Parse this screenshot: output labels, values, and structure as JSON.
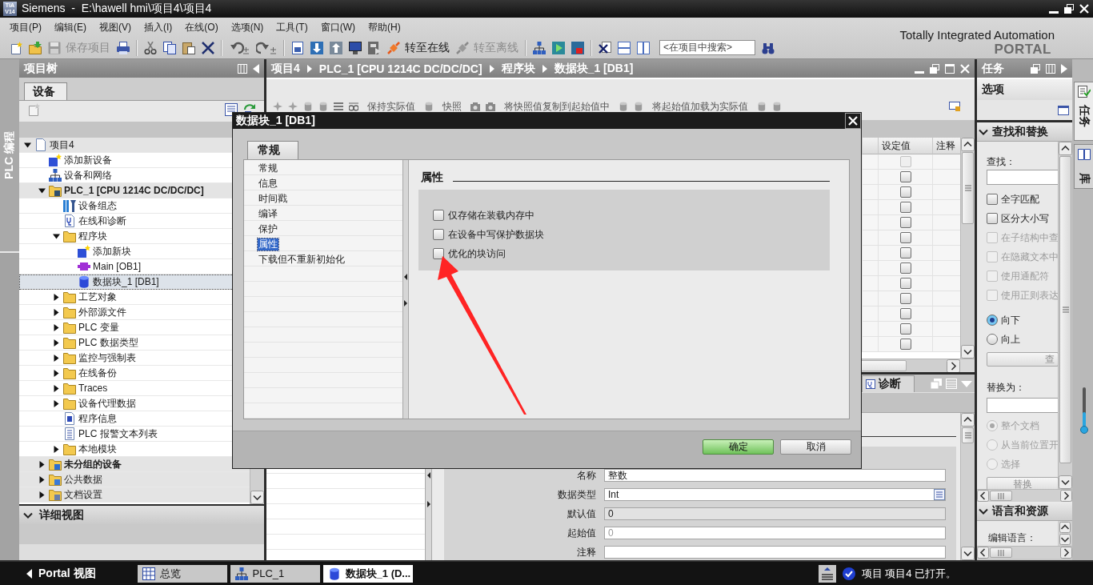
{
  "window": {
    "logo": [
      "TIA",
      "V14"
    ],
    "title": "Siemens  -  E:\\hawell hmi\\项目4\\项目4"
  },
  "menu": [
    "项目(P)",
    "编辑(E)",
    "视图(V)",
    "插入(I)",
    "在线(O)",
    "选项(N)",
    "工具(T)",
    "窗口(W)",
    "帮助(H)"
  ],
  "toolbar": {
    "save": {
      "label": "保存项目",
      "disabled": true
    },
    "online": {
      "label": "转至在线",
      "disabled": false
    },
    "offline": {
      "label": "转至离线",
      "disabled": true
    },
    "search": {
      "placeholder": "<在项目中搜索>"
    }
  },
  "branding": {
    "tagline": "Totally Integrated Automation",
    "product": "PORTAL"
  },
  "left_strip": {
    "tabs": [
      {
        "label": "PLC 编程",
        "selected": true
      }
    ]
  },
  "project_tree": {
    "title": "项目树",
    "tabs": [
      {
        "label": "设备",
        "selected": true
      }
    ],
    "items": [
      {
        "label": "项目4",
        "kind": "project",
        "expanded": true,
        "selected": false,
        "children": [
          {
            "label": "添加新设备",
            "kind": "add",
            "selected": false
          },
          {
            "label": "设备和网络",
            "kind": "network",
            "selected": false
          },
          {
            "label": "PLC_1 [CPU 1214C DC/DC/DC]",
            "kind": "plc",
            "expanded": true,
            "selected": false,
            "children": [
              {
                "label": "设备组态",
                "kind": "config",
                "selected": false
              },
              {
                "label": "在线和诊断",
                "kind": "diagnostics",
                "selected": false
              },
              {
                "label": "程序块",
                "kind": "folder",
                "expanded": true,
                "selected": false,
                "children": [
                  {
                    "label": "添加新块",
                    "kind": "add",
                    "selected": false
                  },
                  {
                    "label": "Main [OB1]",
                    "kind": "ob",
                    "selected": false
                  },
                  {
                    "label": "数据块_1 [DB1]",
                    "kind": "db",
                    "selected": true
                  }
                ]
              },
              {
                "label": "工艺对象",
                "kind": "folder",
                "expanded": false,
                "selected": false
              },
              {
                "label": "外部源文件",
                "kind": "folder",
                "expanded": false,
                "selected": false
              },
              {
                "label": "PLC 变量",
                "kind": "folder",
                "expanded": false,
                "selected": false
              },
              {
                "label": "PLC 数据类型",
                "kind": "folder",
                "expanded": false,
                "selected": false
              },
              {
                "label": "监控与强制表",
                "kind": "folder",
                "expanded": false,
                "selected": false
              },
              {
                "label": "在线备份",
                "kind": "folder",
                "expanded": false,
                "selected": false
              },
              {
                "label": "Traces",
                "kind": "folder",
                "expanded": false,
                "selected": false
              },
              {
                "label": "设备代理数据",
                "kind": "folder",
                "expanded": false,
                "selected": false
              },
              {
                "label": "程序信息",
                "kind": "info",
                "selected": false
              },
              {
                "label": "PLC 报警文本列表",
                "kind": "list",
                "selected": false
              },
              {
                "label": "本地模块",
                "kind": "folder",
                "expanded": false,
                "selected": false
              }
            ]
          },
          {
            "label": "未分组的设备",
            "kind": "ungrouped",
            "expanded": false,
            "selected": false
          },
          {
            "label": "公共数据",
            "kind": "common",
            "expanded": false,
            "selected": false
          },
          {
            "label": "文档设置",
            "kind": "docs",
            "expanded": false,
            "selected": false
          }
        ]
      }
    ]
  },
  "detail_view": {
    "title": "详细视图",
    "expanded": true
  },
  "editor": {
    "breadcrumb": [
      "项目4",
      "PLC_1 [CPU 1214C DC/DC/DC]",
      "程序块",
      "数据块_1 [DB1]"
    ],
    "toolbar": [
      "保持实际值",
      "快照",
      "将快照值复制到起始值中",
      "将起始值加载为实际值"
    ],
    "table": {
      "columns": [
        "设定值",
        "注释"
      ],
      "rows": [
        {
          "setpoint": false,
          "disabled": true
        },
        {
          "setpoint": false,
          "disabled": false
        },
        {
          "setpoint": false,
          "disabled": false
        },
        {
          "setpoint": false,
          "disabled": false
        },
        {
          "setpoint": false,
          "disabled": false
        },
        {
          "setpoint": false,
          "disabled": false
        },
        {
          "setpoint": false,
          "disabled": false
        },
        {
          "setpoint": false,
          "disabled": false
        },
        {
          "setpoint": false,
          "disabled": false
        },
        {
          "setpoint": false,
          "disabled": false
        },
        {
          "setpoint": false,
          "disabled": false
        },
        {
          "setpoint": false,
          "disabled": false
        },
        {
          "setpoint": false,
          "disabled": false
        }
      ]
    },
    "inspector": {
      "tabs": [
        {
          "label": "诊断",
          "selected": true
        }
      ],
      "fields": [
        {
          "label": "名称",
          "kind": "text",
          "value": "整数"
        },
        {
          "label": "数据类型",
          "kind": "dropdown",
          "value": "Int"
        },
        {
          "label": "默认值",
          "kind": "readonly",
          "value": "0"
        },
        {
          "label": "起始值",
          "kind": "text",
          "placeholder": "0"
        },
        {
          "label": "注释",
          "kind": "text"
        }
      ]
    }
  },
  "task_panel": {
    "title": "任务",
    "pane": "选项",
    "find_replace": {
      "title": "查找和替换",
      "expanded": true,
      "find_label": "查找：",
      "options": [
        {
          "label": "全字匹配",
          "checked": false,
          "disabled": false
        },
        {
          "label": "区分大小写",
          "checked": false,
          "disabled": false
        },
        {
          "label": "在子结构中查",
          "checked": false,
          "disabled": true
        },
        {
          "label": "在隐藏文本中",
          "checked": false,
          "disabled": true
        },
        {
          "label": "使用通配符",
          "checked": false,
          "disabled": true
        },
        {
          "label": "使用正则表达",
          "checked": false,
          "disabled": true
        }
      ],
      "directions": [
        {
          "label": "向下",
          "selected": true
        },
        {
          "label": "向上",
          "selected": false
        }
      ],
      "find_button": {
        "label": "查",
        "disabled": true
      },
      "replace_label": "替换为：",
      "scopes": [
        {
          "label": "整个文档",
          "selected": true,
          "disabled": true
        },
        {
          "label": "从当前位置开",
          "selected": false,
          "disabled": true
        },
        {
          "label": "选择",
          "selected": false,
          "disabled": true
        }
      ],
      "replace_button": {
        "label": "替换",
        "disabled": true
      }
    },
    "language": {
      "title": "语言和资源",
      "expanded": true,
      "edit_language_label": "编辑语言："
    }
  },
  "right_strip": {
    "tabs": [
      {
        "label": "任务",
        "kind": "tasks",
        "selected": true
      },
      {
        "label": "库",
        "kind": "library",
        "selected": false
      }
    ],
    "slider": {
      "level": 0.45
    }
  },
  "dialog": {
    "title": "数据块_1 [DB1]",
    "tabs": [
      {
        "label": "常规",
        "selected": true
      }
    ],
    "nav": [
      {
        "label": "常规",
        "selected": false
      },
      {
        "label": "信息",
        "selected": false
      },
      {
        "label": "时间戳",
        "selected": false
      },
      {
        "label": "编译",
        "selected": false
      },
      {
        "label": "保护",
        "selected": false
      },
      {
        "label": "属性",
        "selected": true
      },
      {
        "label": "下载但不重新初始化",
        "selected": false
      }
    ],
    "section": "属性",
    "options": [
      {
        "label": "仅存储在装载内存中",
        "checked": false
      },
      {
        "label": "在设备中写保护数据块",
        "checked": false
      },
      {
        "label": "优化的块访问",
        "checked": false
      }
    ],
    "buttons": [
      {
        "label": "确定",
        "kind": "primary"
      },
      {
        "label": "取消",
        "kind": "secondary"
      }
    ]
  },
  "taskbar": {
    "portal_label": "Portal 视图",
    "tabs": [
      {
        "label": "总览",
        "kind": "overview",
        "selected": false
      },
      {
        "label": "PLC_1",
        "kind": "device",
        "selected": false
      },
      {
        "label": "数据块_1 (D...",
        "kind": "block",
        "selected": true
      }
    ],
    "status": "项目 项目4 已打开。"
  }
}
